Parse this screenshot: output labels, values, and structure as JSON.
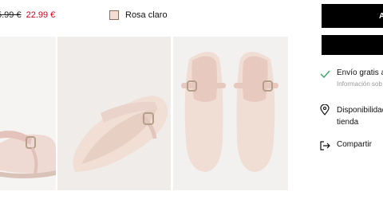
{
  "price": {
    "old": "5.99 €",
    "new": "22.99 €"
  },
  "color": {
    "name": "Rosa claro",
    "swatch": "#f2ddd4"
  },
  "actions": {
    "primary_label": "A"
  },
  "info": {
    "shipping_title": "Envío gratis a",
    "shipping_sub": "Información sob",
    "availability": "Disponibilidad\ntienda",
    "share": "Compartir"
  },
  "colors": {
    "sale": "#d0021b",
    "check": "#3aa35c",
    "button": "#000000"
  },
  "icons": [
    "check-icon",
    "location-pin-icon",
    "share-icon"
  ]
}
